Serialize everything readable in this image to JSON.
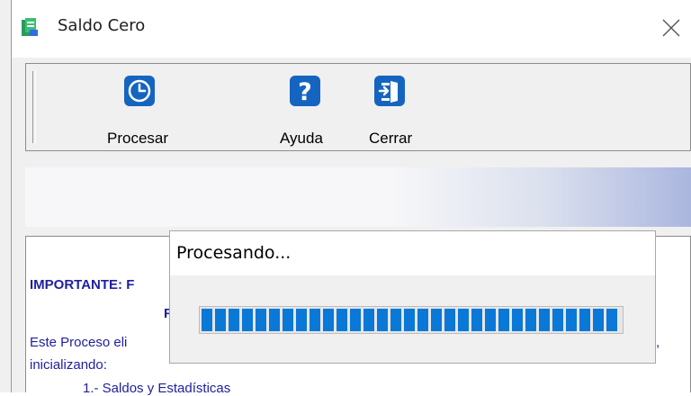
{
  "window": {
    "title": "Saldo Cero",
    "app_icon": "green-document-icon",
    "close_icon": "close-icon"
  },
  "toolbar": {
    "buttons": [
      {
        "label": "Procesar",
        "icon": "clock-icon"
      },
      {
        "label": "Ayuda",
        "icon": "help-question-icon"
      },
      {
        "label": "Cerrar",
        "icon": "exit-door-icon"
      }
    ]
  },
  "content": {
    "important_label": "IMPORTANTE:",
    "important_fragment": "F",
    "line_fragment": "F",
    "line1": "Este Proceso eli",
    "line1_end": ",",
    "line2": "inicializando:",
    "line3": "1.- Saldos y Estadísticas"
  },
  "dialog": {
    "title": "Procesando...",
    "progress": 1.0
  },
  "colors": {
    "icon_blue": "#1565c0",
    "progress_blue": "#0a78d7",
    "text_blue": "#2020a0"
  }
}
